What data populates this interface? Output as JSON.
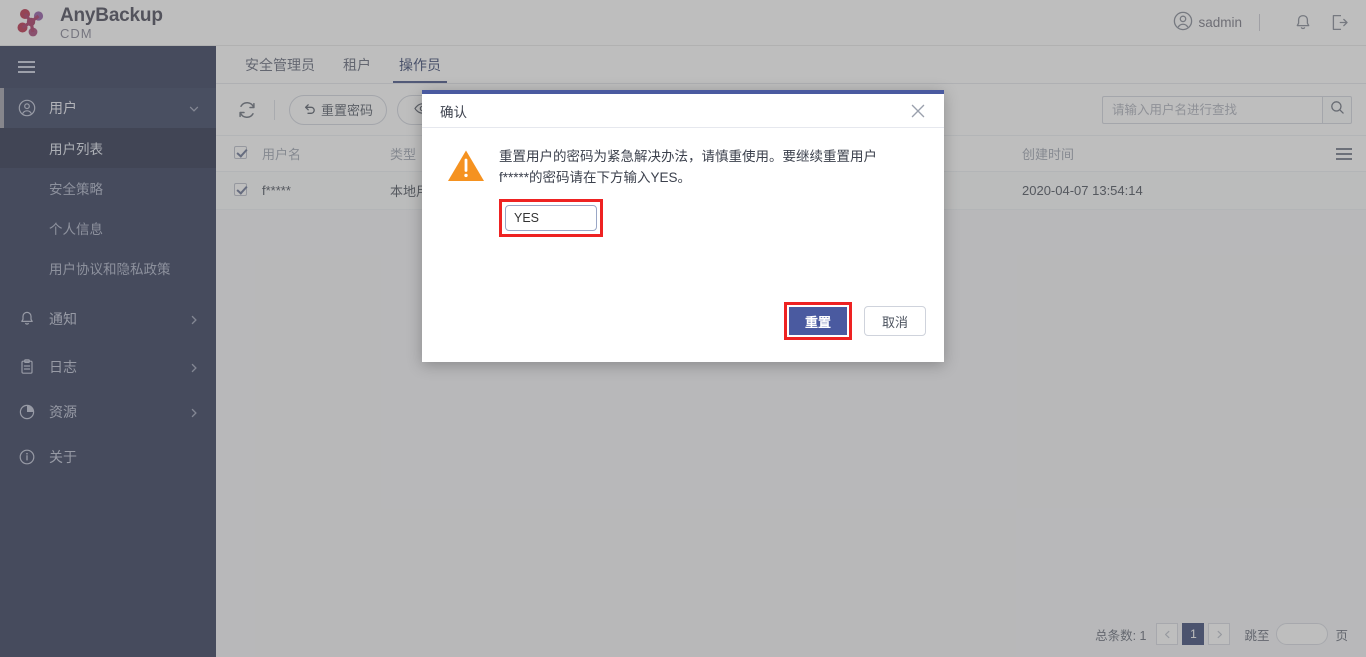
{
  "header": {
    "logo_title": "AnyBackup",
    "logo_sub": "CDM",
    "username": "sadmin",
    "user_icon": "user-circle-icon",
    "bell_icon": "bell-icon",
    "logout_icon": "logout-icon"
  },
  "sidebar": {
    "menu_icon": "hamburger-menu-icon",
    "groups": [
      {
        "label": "用户",
        "icon": "user-circle-icon",
        "chevron": "chevron-down-icon",
        "active": true,
        "children": [
          {
            "label": "用户列表",
            "selected": true
          },
          {
            "label": "安全策略",
            "selected": false
          },
          {
            "label": "个人信息",
            "selected": false
          },
          {
            "label": "用户协议和隐私政策",
            "selected": false
          }
        ]
      },
      {
        "label": "通知",
        "icon": "bell-icon",
        "chevron": "chevron-right-icon",
        "active": false,
        "children": []
      },
      {
        "label": "日志",
        "icon": "clipboard-icon",
        "chevron": "chevron-right-icon",
        "active": false,
        "children": []
      },
      {
        "label": "资源",
        "icon": "pie-chart-icon",
        "chevron": "chevron-right-icon",
        "active": false,
        "children": []
      },
      {
        "label": "关于",
        "icon": "info-circle-icon",
        "chevron": "",
        "active": false,
        "children": []
      }
    ]
  },
  "tabs": [
    {
      "label": "安全管理员",
      "active": false
    },
    {
      "label": "租户",
      "active": false
    },
    {
      "label": "操作员",
      "active": true
    }
  ],
  "toolbar": {
    "refresh_icon": "refresh-icon",
    "reset_password_label": "重置密码",
    "reset_password_icon": "undo-arrow-icon",
    "view_icon": "eye-icon"
  },
  "search": {
    "placeholder": "请输入用户名进行查找",
    "value": "",
    "icon": "search-icon"
  },
  "table": {
    "columns": [
      "用户名",
      "类型",
      "创建时间"
    ],
    "menu_icon": "hamburger-column-icon",
    "rows": [
      {
        "checked": true,
        "username": "f*****",
        "type": "本地用户",
        "created": "2020-04-07 13:54:14"
      }
    ],
    "header_checked": true
  },
  "pagination": {
    "total_label": "总条数: 1",
    "prev_icon": "chevron-left-icon",
    "next_icon": "chevron-right-icon",
    "current_page": "1",
    "jump_label": "跳至",
    "jump_value": "",
    "unit_label": "页"
  },
  "modal": {
    "title": "确认",
    "close_icon": "close-icon",
    "warning_icon": "warning-triangle-icon",
    "message": "重置用户的密码为紧急解决办法，请慎重使用。要继续重置用户 f*****的密码请在下方输入YES。",
    "input_value": "YES",
    "input_placeholder": "",
    "confirm_label": "重置",
    "cancel_label": "取消"
  },
  "colors": {
    "sidebar_bg": "#252f4f",
    "accent": "#4a5aa0",
    "highlight_red": "#ee2222",
    "warning_orange": "#f59220"
  }
}
